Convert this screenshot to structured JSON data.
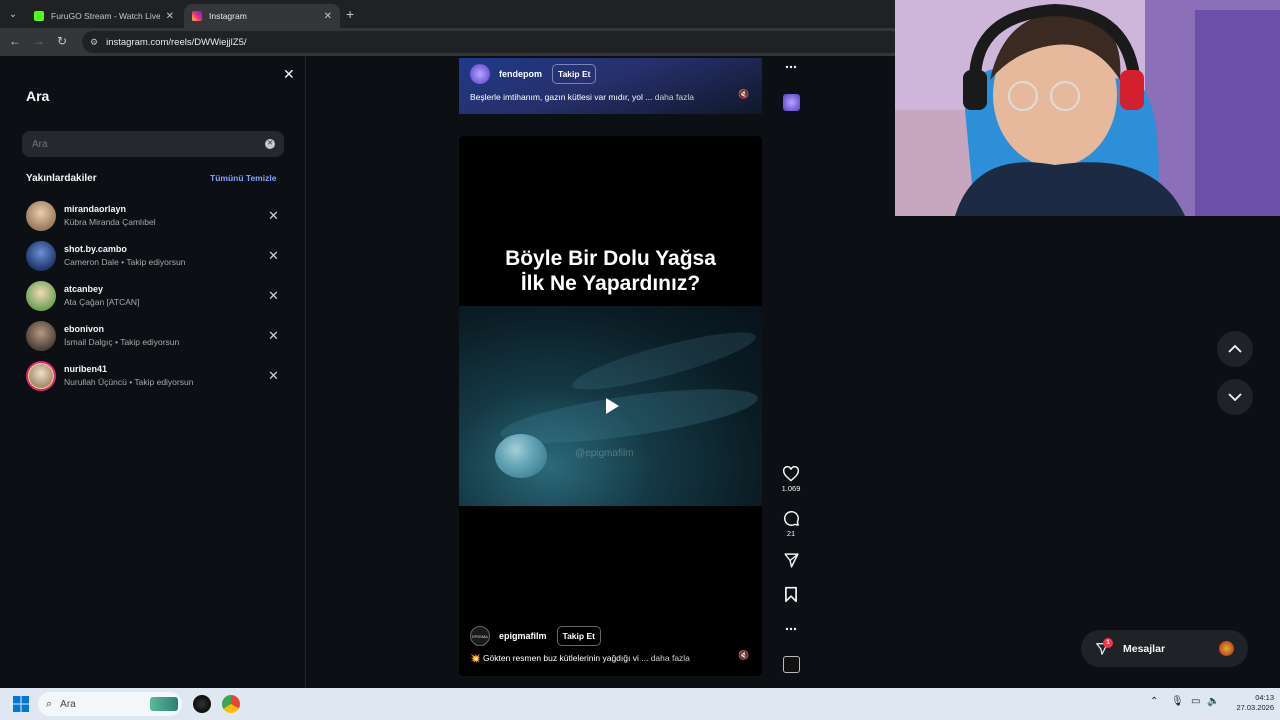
{
  "browser": {
    "tabs": [
      {
        "title": "FuruGO Stream - Watch Live on",
        "favicon_color": "#53fc18",
        "active": false
      },
      {
        "title": "Instagram",
        "favicon_color": "#e1306c",
        "active": true
      }
    ],
    "url": "instagram.com/reels/DWWiejjlZ5/"
  },
  "search_panel": {
    "title": "Ara",
    "search_placeholder": "Ara",
    "recent_heading": "Yakınlardakiler",
    "clear_all_label": "Tümünü Temizle",
    "recent": [
      {
        "username": "mirandaorlayn",
        "subtitle": "Kübra Miranda Çamlıbel",
        "avatar_color": "#c9a27e"
      },
      {
        "username": "shot.by.cambo",
        "subtitle": "Cameron Dale • Takip ediyorsun",
        "avatar_color": "#3b5fa8"
      },
      {
        "username": "atcanbey",
        "subtitle": "Ata Çağan [ATCAN]",
        "avatar_color": "#8fb86a"
      },
      {
        "username": "ebonivon",
        "subtitle": "İsmail Dalgıç • Takip ediyorsun",
        "avatar_color": "#6b5a4a"
      },
      {
        "username": "nuriben41",
        "subtitle": "Nurullah Üçüncü • Takip ediyorsun",
        "avatar_color": "#d9c3a8"
      }
    ]
  },
  "reel_previous": {
    "username": "fendepom",
    "follow_label": "Takip Et",
    "caption": "Beşlerle imtihanım, gazın kütlesi var mıdır, yol ...",
    "more_label": "daha fazla"
  },
  "reel_current": {
    "headline_line1": "Böyle Bir Dolu Yağsa",
    "headline_line2": "İlk Ne Yapardınız?",
    "watermark": "@epigmafilm",
    "username": "epigmafilm",
    "avatar_text": "EPIGMA",
    "follow_label": "Takip Et",
    "caption": "💥 Gökten resmen buz kütlelerinin yağdığı vi ...",
    "more_label": "daha fazla",
    "likes": "1.069",
    "comments": "21"
  },
  "messages": {
    "label": "Mesajlar",
    "badge_count": "1"
  },
  "taskbar": {
    "search_placeholder": "Ara",
    "time": "04:13",
    "date": "27.03.2026"
  }
}
